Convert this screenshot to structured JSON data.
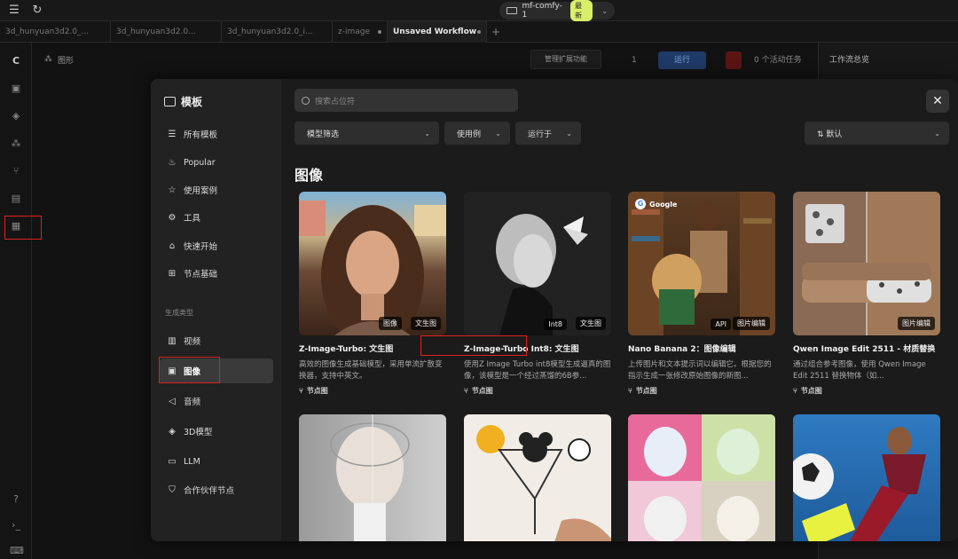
{
  "topbar": {
    "server_name": "mf-comfy-1",
    "server_badge": "最新"
  },
  "tabs": [
    {
      "label": "3d_hunyuan3d2.0_...",
      "active": false
    },
    {
      "label": "3d_hunyuan3d2.0...",
      "active": false
    },
    {
      "label": "3d_hunyuan3d2.0_i...",
      "active": false
    },
    {
      "label": "z-image",
      "active": false
    },
    {
      "label": "Unsaved Workflow",
      "active": true
    }
  ],
  "background": {
    "graph_label": "图形",
    "manage_ext": "管理扩展功能",
    "queue_count": "1",
    "run_label": "运行",
    "active_tasks": "0 个活动任务",
    "right_panel_title": "工作流总览"
  },
  "modal": {
    "header": "模板",
    "nav_items": [
      {
        "label": "所有模板",
        "icon": "list-icon"
      },
      {
        "label": "Popular",
        "icon": "flame-icon"
      },
      {
        "label": "使用案例",
        "icon": "star-icon"
      },
      {
        "label": "工具",
        "icon": "gear-icon"
      },
      {
        "label": "快速开始",
        "icon": "graduation-icon"
      },
      {
        "label": "节点基础",
        "icon": "puzzle-icon"
      }
    ],
    "gen_type_label": "生成类型",
    "gen_items": [
      {
        "label": "视频",
        "icon": "film-icon"
      },
      {
        "label": "图像",
        "icon": "image-icon",
        "active": true
      },
      {
        "label": "音频",
        "icon": "speaker-icon"
      },
      {
        "label": "3D模型",
        "icon": "cube-icon"
      },
      {
        "label": "LLM",
        "icon": "chat-icon"
      },
      {
        "label": "合作伙伴节点",
        "icon": "shield-icon"
      }
    ],
    "search_placeholder": "搜索占位符",
    "filters": {
      "model": "模型筛选",
      "use_case": "使用例",
      "run_on": "运行于",
      "sort": "默认"
    },
    "section_title": "图像",
    "cards": [
      {
        "title": "Z-Image-Turbo: 文生图",
        "desc": "高效的图像生成基础模型，采用单流扩散变换器，支持中英文。",
        "tags": [
          "图像",
          "文生图"
        ],
        "node_label": "节点图"
      },
      {
        "title": "Z-Image-Turbo Int8: 文生图",
        "desc": "使用Z Image Turbo int8模型生成逼真的图像，该模型是一个经过蒸馏的6B参...",
        "tags": [
          "Int8",
          "文生图"
        ],
        "node_label": "节点图"
      },
      {
        "title": "Nano Banana 2：图像编辑",
        "desc": "上传图片和文本提示词以编辑它。根据您的指示生成一张修改原始图像的新图...",
        "tags": [
          "API",
          "图片编辑"
        ],
        "node_label": "节点图",
        "brand": "Google"
      },
      {
        "title": "Qwen Image Edit 2511 - 材质替换",
        "desc": "通过组合参考图像，使用 Qwen Image Edit 2511 替换物体（如...",
        "tags": [
          "图片编辑"
        ],
        "node_label": "节点图"
      }
    ]
  }
}
